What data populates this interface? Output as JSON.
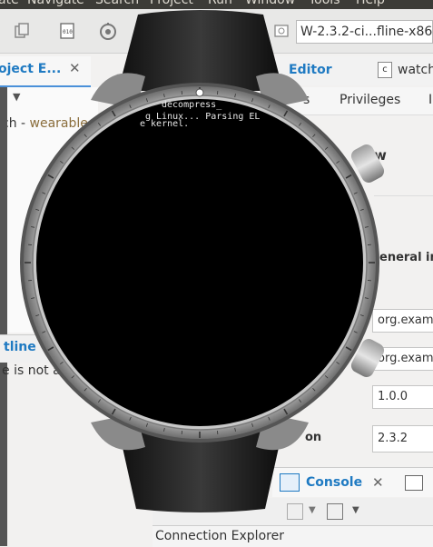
{
  "menubar": {
    "items": [
      "ate",
      "Navigate",
      "Search",
      "Project",
      "Run",
      "Window",
      "Tools",
      "Help"
    ]
  },
  "toolbar": {
    "launch_config": "W-2.3.2-ci...fline-x86)"
  },
  "left_tabs": {
    "project_explorer": "oject E...",
    "close": "✕"
  },
  "left_panel": {
    "tree_item_prefix": "ch - ",
    "tree_item_link": "wearable"
  },
  "outline": {
    "title": "tline",
    "message": "e is not a"
  },
  "editor_tabs": {
    "active": "Editor",
    "second": "watch",
    "second_icon": "c"
  },
  "editor_subtabs": {
    "first_fragment": "s",
    "privileges": "Privileges",
    "more": "I"
  },
  "editor_right": {
    "overview_fragment": "w",
    "general_info": "eneral inf",
    "version_label": "on",
    "fields": {
      "package": "org.examp",
      "app_id": "org.examp",
      "version": "1.0.0",
      "required_version": "2.3.2"
    }
  },
  "console": {
    "tab_label": "Console",
    "close": "✕"
  },
  "connection_explorer": {
    "title": "Connection Explorer"
  },
  "watch_screen": {
    "lines": [
      "decompress_",
      "g Linux... Parsing EL",
      "e kernel."
    ]
  },
  "colors": {
    "accent": "#1f7ac2",
    "link": "#8a6d3b"
  }
}
